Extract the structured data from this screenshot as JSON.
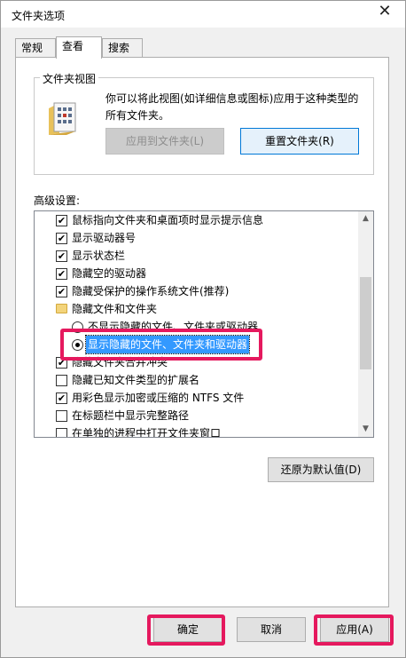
{
  "window": {
    "title": "文件夹选项",
    "close_glyph": "✕"
  },
  "tabs": [
    {
      "label": "常规",
      "active": false
    },
    {
      "label": "查看",
      "active": true
    },
    {
      "label": "搜索",
      "active": false
    }
  ],
  "folder_views": {
    "group_title": "文件夹视图",
    "description": "你可以将此视图(如详细信息或图标)应用于这种类型的所有文件夹。",
    "apply_button": "应用到文件夹(L)",
    "reset_button": "重置文件夹(R)"
  },
  "advanced": {
    "label": "高级设置:",
    "items": [
      {
        "type": "checkbox",
        "label": "鼠标指向文件夹和桌面项时显示提示信息",
        "checked": true
      },
      {
        "type": "checkbox",
        "label": "显示驱动器号",
        "checked": true
      },
      {
        "type": "checkbox",
        "label": "显示状态栏",
        "checked": true
      },
      {
        "type": "checkbox",
        "label": "隐藏空的驱动器",
        "checked": true
      },
      {
        "type": "checkbox",
        "label": "隐藏受保护的操作系统文件(推荐)",
        "checked": true
      },
      {
        "type": "folder",
        "label": "隐藏文件和文件夹"
      },
      {
        "type": "radio",
        "label": "不显示隐藏的文件、文件夹或驱动器",
        "selected": false
      },
      {
        "type": "radio",
        "label": "显示隐藏的文件、文件夹和驱动器",
        "selected": true
      },
      {
        "type": "checkbox",
        "label": "隐藏文件夹合并冲突",
        "checked": true
      },
      {
        "type": "checkbox",
        "label": "隐藏已知文件类型的扩展名",
        "checked": false
      },
      {
        "type": "checkbox",
        "label": "用彩色显示加密或压缩的 NTFS 文件",
        "checked": true
      },
      {
        "type": "checkbox",
        "label": "在标题栏中显示完整路径",
        "checked": false
      },
      {
        "type": "checkbox",
        "label": "在单独的进程中打开文件夹窗口",
        "checked": false
      }
    ]
  },
  "restore_defaults_button": "还原为默认值(D)",
  "footer": {
    "ok": "确定",
    "cancel": "取消",
    "apply": "应用(A)"
  },
  "colors": {
    "highlight": "#e5195e",
    "selection": "#3399ff",
    "focus_border": "#0078d7"
  },
  "icons": {
    "folder_view": "folder-grid-icon",
    "close": "close-icon",
    "scroll_up": "scroll-up-arrow-icon",
    "scroll_down": "scroll-down-arrow-icon"
  }
}
